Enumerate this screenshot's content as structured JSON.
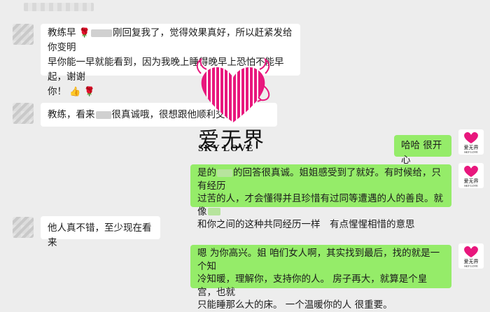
{
  "watermark": {
    "title": "爱无界",
    "subtitle": "SKY LOVE"
  },
  "messages": [
    {
      "side": "left",
      "segments": [
        "教练早",
        "刚回复我了，觉得效果真好，所以赶紧发给你变明",
        "早你能一早就能看到，因为我晚上睡得晚早上恐怕不能早起，谢谢",
        "你！"
      ]
    },
    {
      "side": "left",
      "segments": [
        "教练，看来",
        "很真诚哦，很想跟他顺利交往"
      ]
    },
    {
      "side": "right",
      "text": "哈哈 很开心"
    },
    {
      "side": "right",
      "segments": [
        "是的",
        "的回答很真诚。姐姐感受到了就好。有时候给，只有经历",
        "过苦的人，才会懂得并且珍惜有过同等遭遇的人的善良。就像",
        "和你之间的这种共同经历一样　有点惺惺相惜的意思"
      ]
    },
    {
      "side": "left",
      "text": "他人真不错，至少现在看来"
    },
    {
      "side": "right",
      "lines": [
        "嗯 为你高兴。姐 咱们女人啊，其实找到最后，找的就是一个知",
        "冷知暖，理解你，支持你的人。 房子再大，就算是个皇宫，也就",
        "只能睡那么大的床。 一个温暖你的人 很重要。"
      ]
    }
  ],
  "avatar_logo": {
    "title": "爱无界",
    "subtitle": "SKY LOVE"
  },
  "colors": {
    "background": "#ededed",
    "bubble_left": "#ffffff",
    "bubble_right": "#95ec69",
    "brand_pink": "#e8177d"
  },
  "icons": [
    "rose-emoji-icon",
    "thumbs-up-emoji-icon",
    "heart-logo-icon"
  ]
}
